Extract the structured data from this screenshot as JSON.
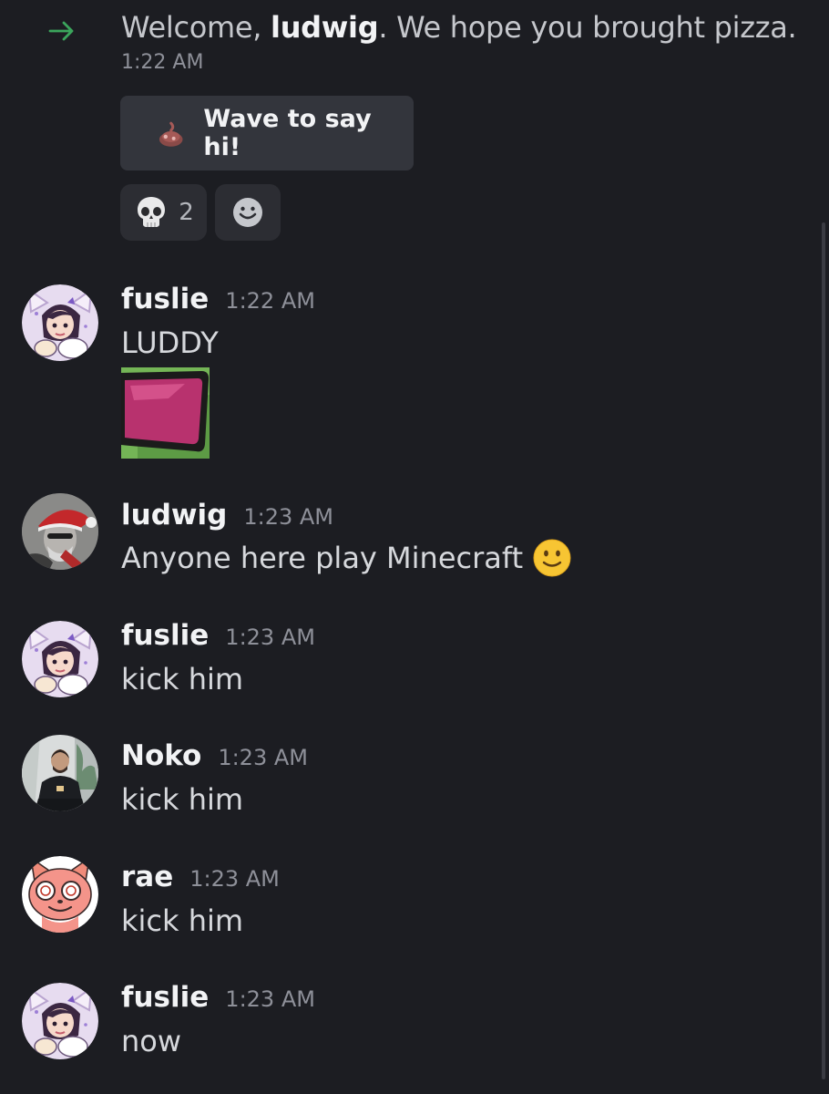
{
  "system_message": {
    "prefix": "Welcome, ",
    "username": "ludwig",
    "suffix": ". We hope you brought pizza.",
    "time": "1:22 AM",
    "arrow_icon": "arrow-right-icon",
    "arrow_color": "#3ba55c",
    "wave_button": {
      "label": "Wave to say hi!",
      "icon": "wave-sticker-icon"
    },
    "reactions": [
      {
        "emoji": "skull",
        "count": "2"
      },
      {
        "emoji": "add-reaction",
        "count": ""
      }
    ]
  },
  "messages": [
    {
      "author": "fuslie",
      "time": "1:22 AM",
      "text": "LUDDY",
      "avatar": "fuslie-cat-avatar",
      "sticker": "pepe-sunglasses-emote"
    },
    {
      "author": "ludwig",
      "time": "1:23 AM",
      "text": "Anyone here play Minecraft",
      "avatar": "ludwig-santa-avatar",
      "emoji": "slight-smile"
    },
    {
      "author": "fuslie",
      "time": "1:23 AM",
      "text": "kick him",
      "avatar": "fuslie-cat-avatar"
    },
    {
      "author": "Noko",
      "time": "1:23 AM",
      "text": "kick him",
      "avatar": "noko-photo-avatar"
    },
    {
      "author": "rae",
      "time": "1:23 AM",
      "text": "kick him",
      "avatar": "rae-fox-avatar"
    },
    {
      "author": "fuslie",
      "time": "1:23 AM",
      "text": "now",
      "avatar": "fuslie-cat-avatar"
    }
  ],
  "colors": {
    "background": "#1c1d22",
    "username_text": "#f2f3f5",
    "message_text": "#d6d8dc",
    "timestamp_text": "#8e9099",
    "reaction_background": "#2c2d33",
    "button_background": "#33353c"
  }
}
